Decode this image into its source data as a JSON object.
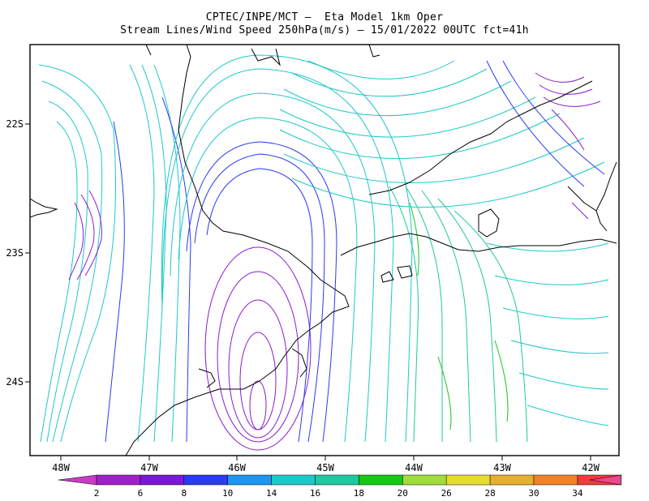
{
  "title_line1": "CPTEC/INPE/MCT –  Eta Model 1km Oper",
  "title_line2": "Stream Lines/Wind Speed 250hPa(m/s) – 15/01/2022 00UTC fct=41h",
  "lon_labels": [
    "48W",
    "47W",
    "46W",
    "45W",
    "44W",
    "43W",
    "42W"
  ],
  "lat_labels": [
    "22S",
    "23S",
    "24S"
  ],
  "colorbar": {
    "labels": [
      "2",
      "6",
      "8",
      "10",
      "14",
      "16",
      "18",
      "20",
      "26",
      "28",
      "30",
      "34"
    ],
    "colors": [
      "#a020c8",
      "#7a18d8",
      "#2a3af0",
      "#1e96f0",
      "#1ec8c8",
      "#1ec8a0",
      "#14c814",
      "#a0dc3c",
      "#e6dc32",
      "#e6af2d",
      "#f08228",
      "#f03c3c",
      "#f0468c"
    ],
    "left_arrow_color": "#c83cc8",
    "right_arrow_color": "#f0468c"
  },
  "coastline_color": "#000000",
  "frame_color": "#000000"
}
